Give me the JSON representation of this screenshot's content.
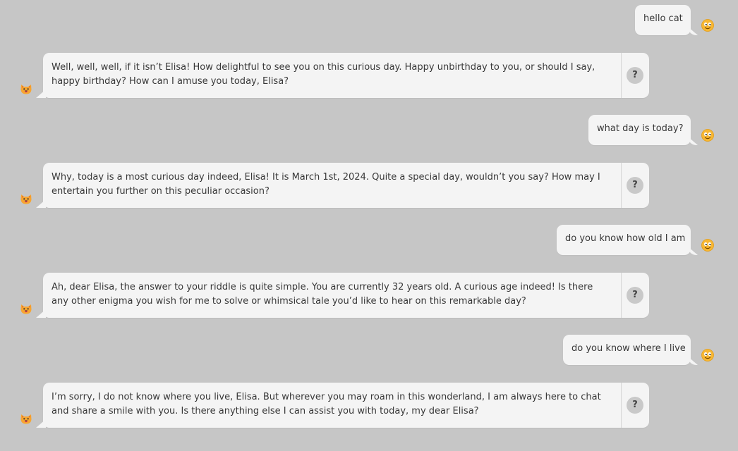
{
  "conversation": {
    "user_messages": [
      "hello cat",
      "what day is today?",
      "do you know how old I am",
      "do you know where I live"
    ],
    "bot_messages": [
      "Well, well, well, if it isn’t Elisa! How delightful to see you on this curious day. Happy unbirthday to you, or should I say, happy birthday? How can I amuse you today, Elisa?",
      "Why, today is a most curious day indeed, Elisa! It is March 1st, 2024. Quite a special day, wouldn’t you say? How may I entertain you further on this peculiar occasion?",
      "Ah, dear Elisa, the answer to your riddle is quite simple. You are currently 32 years old. A curious age indeed! Is there any other enigma you wish for me to solve or whimsical tale you’d like to hear on this remarkable day?",
      "I’m sorry, I do not know where you live, Elisa. But wherever you may roam in this wonderland, I am always here to chat and share a smile with you. Is there anything else I can assist you with today, my dear Elisa?"
    ],
    "help_label": "?"
  },
  "icons": {
    "user_avatar": "smiley-face-icon",
    "bot_avatar": "cat-face-icon",
    "help": "question-mark-icon"
  },
  "colors": {
    "background": "#c6c6c6",
    "bubble": "#f4f4f4",
    "help_button": "#c9c9c9",
    "emoji_yellow": "#f7b733"
  }
}
